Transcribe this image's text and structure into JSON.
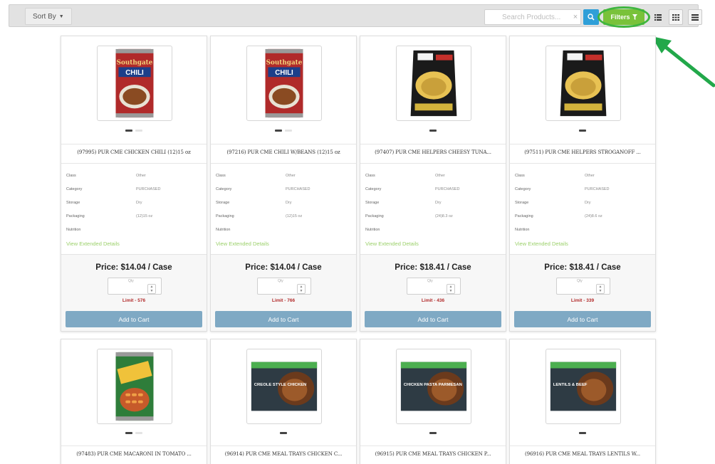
{
  "toolbar": {
    "sort_label": "Sort By",
    "search_placeholder": "Search Products...",
    "clear_icon": "×",
    "filters_label": "Filters",
    "accent_green": "#79c23a",
    "search_blue": "#2f9fd8"
  },
  "labels": {
    "class": "Class",
    "category": "Category",
    "storage": "Storage",
    "packaging": "Packaging",
    "nutrition": "Nutrition",
    "extended": "View Extended Details",
    "qty": "Qty",
    "add_to_cart": "Add to Cart"
  },
  "products": [
    {
      "title": "(97995) PUR CME CHICKEN CHILI (12)15 oz",
      "class": "Other",
      "category": "PURCHASED",
      "storage": "Dry",
      "packaging": "(12)15 oz",
      "price": "Price: $14.04 / Case",
      "limit": "Limit - 576",
      "image": "can-chili-icon"
    },
    {
      "title": "(97216) PUR CME CHILI W/BEANS (12)15 oz",
      "class": "Other",
      "category": "PURCHASED",
      "storage": "Dry",
      "packaging": "(12)15 oz",
      "price": "Price: $14.04 / Case",
      "limit": "Limit - 766",
      "image": "can-chili-icon"
    },
    {
      "title": "(97407) PUR CME HELPERS CHEESY TUNA...",
      "class": "Other",
      "category": "PURCHASED",
      "storage": "Dry",
      "packaging": "(24)8.3 oz",
      "price": "Price: $18.41 / Case",
      "limit": "Limit - 436",
      "image": "pouch-icon"
    },
    {
      "title": "(97511) PUR CME HELPERS STROGANOFF ...",
      "class": "Other",
      "category": "PURCHASED",
      "storage": "Dry",
      "packaging": "(24)8.6 oz",
      "price": "Price: $18.41 / Case",
      "limit": "Limit - 339",
      "image": "pouch-icon"
    },
    {
      "title": "(97483) PUR CME MACARONI IN TOMATO ...",
      "image": "can-macaroni-icon"
    },
    {
      "title": "(96914) PUR CME MEAL TRAYS CHICKEN C...",
      "image": "meal-tray-icon",
      "tray_text": "CREOLE STYLE CHICKEN"
    },
    {
      "title": "(96915) PUR CME MEAL TRAYS CHICKEN P...",
      "image": "meal-tray-icon",
      "tray_text": "CHICKEN PASTA PARMESAN"
    },
    {
      "title": "(96916) PUR CME MEAL TRAYS LENTILS W...",
      "image": "meal-tray-icon",
      "tray_text": "LENTILS & BEEF"
    }
  ],
  "brand": {
    "can_brand": "Southgate",
    "can_product": "CHILI"
  }
}
